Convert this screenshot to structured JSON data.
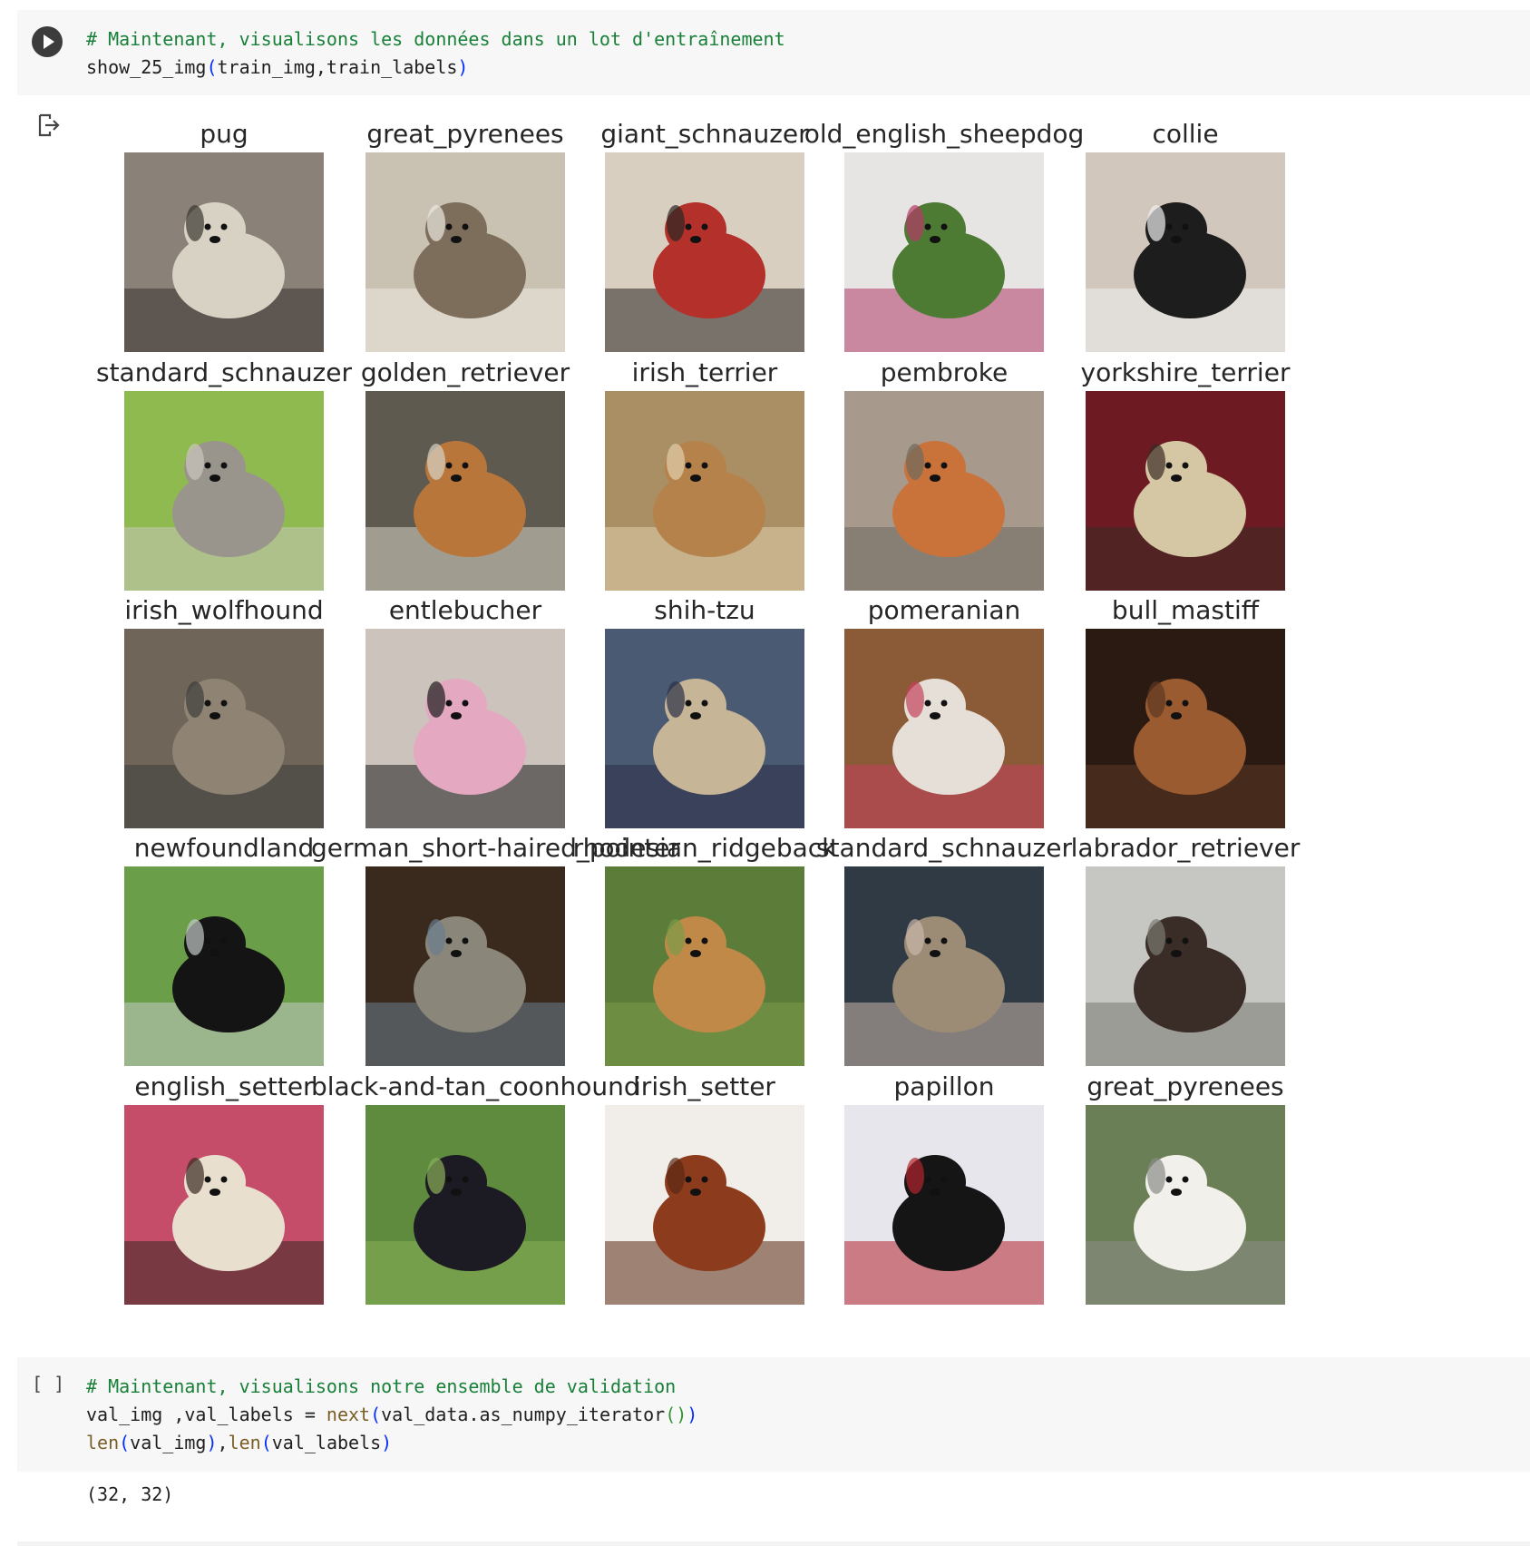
{
  "cell_train": {
    "comment": "# Maintenant, visualisons les données dans un lot d'entraînement",
    "code_fn": "show_25_img",
    "code_args": "train_img,train_labels",
    "run_button_label": "run-cell"
  },
  "output_icon": "output-redirect-icon",
  "grid": {
    "labels": [
      "pug",
      "great_pyrenees",
      "giant_schnauzer",
      "old_english_sheepdog",
      "collie",
      "standard_schnauzer",
      "golden_retriever",
      "irish_terrier",
      "pembroke",
      "yorkshire_terrier",
      "irish_wolfhound",
      "entlebucher",
      "shih-tzu",
      "pomeranian",
      "bull_mastiff",
      "newfoundland",
      "german_short-haired_pointer",
      "rhodesian_ridgeback",
      "standard_schnauzer",
      "labrador_retriever",
      "english_setter",
      "black-and-tan_coonhound",
      "irish_setter",
      "papillon",
      "great_pyrenees"
    ],
    "colors": [
      [
        "#8a8278",
        "#d8d2c4",
        "#3a3531"
      ],
      [
        "#c9c1b2",
        "#7d6e5c",
        "#ece8e0"
      ],
      [
        "#d9cfc1",
        "#b4302a",
        "#2a2624"
      ],
      [
        "#e7e5e4",
        "#4e7b33",
        "#b33a68"
      ],
      [
        "#d1c7bc",
        "#1d1d1d",
        "#efefef"
      ],
      [
        "#8fba4f",
        "#9a958c",
        "#cbc6bd"
      ],
      [
        "#5f5a4f",
        "#b8763b",
        "#d6d3c7"
      ],
      [
        "#a98f63",
        "#b5824b",
        "#e0cfae"
      ],
      [
        "#a8998d",
        "#c9733a",
        "#6e6a60"
      ],
      [
        "#6d1a22",
        "#d5c6a4",
        "#3a2b24"
      ],
      [
        "#6f6659",
        "#8f8473",
        "#3d3d3c"
      ],
      [
        "#ccc4bc",
        "#e4a9c1",
        "#1d1d1d"
      ],
      [
        "#4a5a72",
        "#c7b597",
        "#2b3047"
      ],
      [
        "#8b5a37",
        "#e6dfd7",
        "#c3415d"
      ],
      [
        "#2a1a12",
        "#9a5b31",
        "#5c3822"
      ],
      [
        "#6b9e48",
        "#141414",
        "#c2c9c7"
      ],
      [
        "#3a2a1e",
        "#8a8679",
        "#6a7d8e"
      ],
      [
        "#5c7d3a",
        "#c08948",
        "#7a9b49"
      ],
      [
        "#2f3a44",
        "#9c8c76",
        "#c9b5aa"
      ],
      [
        "#c6c6c3",
        "#3a2c26",
        "#7a7a72"
      ],
      [
        "#c54d6a",
        "#e9dfcf",
        "#3a2a22"
      ],
      [
        "#5e8b3d",
        "#1c1a22",
        "#8ab05a"
      ],
      [
        "#f1eeea",
        "#8c3b1c",
        "#5a2a12"
      ],
      [
        "#e7e6ec",
        "#151515",
        "#b2232e"
      ],
      [
        "#6b7f56",
        "#f2f0eb",
        "#8a8c89"
      ]
    ]
  },
  "cell_val": {
    "comment": "# Maintenant, visualisons notre ensemble de validation",
    "line2_a": "val_img ,val_labels = ",
    "line2_fn": "next",
    "line2_b": "val_data.as_numpy_iterator",
    "line3_fn1": "len",
    "line3_a1": "val_img",
    "line3_fn2": "len",
    "line3_a2": "val_labels",
    "bracket": "[ ]",
    "output": "(32, 32)"
  }
}
